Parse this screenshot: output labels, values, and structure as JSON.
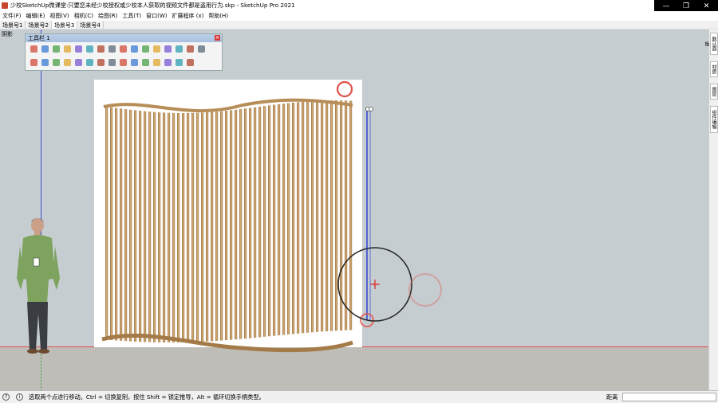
{
  "window": {
    "title": "少校SketchUp微课堂:只要您未经少校授权或少校本人获取的视频文件都是盗用行为.skp - SketchUp Pro 2021",
    "minimize_glyph": "—",
    "maximize_glyph": "❐",
    "close_glyph": "✕"
  },
  "menu": {
    "items": [
      {
        "label": "文件(F)"
      },
      {
        "label": "编辑(E)"
      },
      {
        "label": "视图(V)"
      },
      {
        "label": "相机(C)"
      },
      {
        "label": "绘图(R)"
      },
      {
        "label": "工具(T)"
      },
      {
        "label": "窗口(W)"
      },
      {
        "label": "扩展程序 (x)"
      },
      {
        "label": "帮助(H)"
      }
    ]
  },
  "scenes": {
    "tabs": [
      {
        "label": "场景号1"
      },
      {
        "label": "场景号2"
      },
      {
        "label": "场景号3",
        "active": true
      },
      {
        "label": "场景号4"
      }
    ]
  },
  "viewport": {
    "shadow_label": "阴影",
    "sky_color": "#c6cdd1",
    "ground_color": "#bfbdb8"
  },
  "toolbar": {
    "title": "工具栏 1",
    "close_glyph": "✕",
    "row1": [
      "select-icon",
      "arc-icon",
      "scale-icon",
      "orbit-icon",
      "rect-icon",
      "pencil-icon",
      "follow-me-icon",
      "offset-icon",
      "push-pull-icon",
      "paint-icon",
      "section-icon",
      "axes-icon",
      "components-icon",
      "sandbox-icon",
      "3d-text-icon",
      "position-camera-icon"
    ],
    "row2": [
      "camera-icon",
      "layers-icon",
      "line-icon",
      "push-icon",
      "solid-icon",
      "intersect-icon",
      "subtract-icon",
      "trim-icon",
      "split-icon",
      "union-icon",
      "shell-icon",
      "zoom-extents-icon",
      "paint-bucket-icon",
      "warehouse-icon",
      "send-icon"
    ]
  },
  "status": {
    "hint": "选取两个点进行移动。Ctrl = 切换复制，按住 Shift = 锁定推导，Alt = 循环切换手柄类型。",
    "measure_label": "距离",
    "measure_value": ""
  },
  "right_dock": {
    "tabs": [
      {
        "label": "默认面板"
      },
      {
        "label": "材质"
      },
      {
        "label": "图层"
      },
      {
        "label": "组件编辑"
      }
    ]
  },
  "colors": {
    "wood": "#c9a06b",
    "wood_dark": "#a47b48",
    "red_axis": "#e24a4a",
    "blue_axis": "#3a52d0",
    "highlight_circle": "#e0524a"
  }
}
